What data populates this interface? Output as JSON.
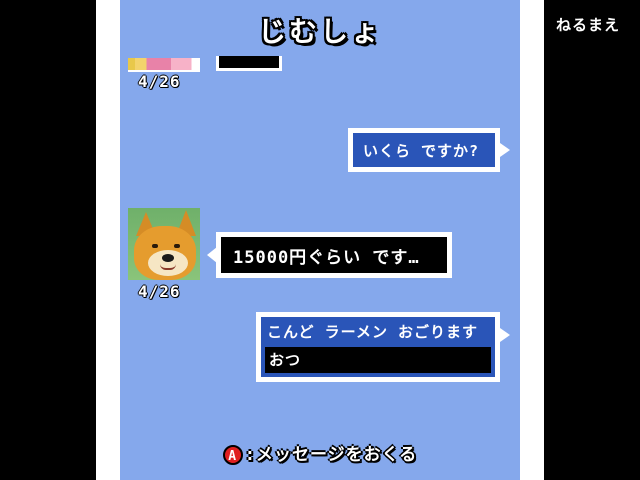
{
  "screen": {
    "title": "じむしょ",
    "corner_label": "ねるまえ"
  },
  "messages": [
    {
      "from": "contact",
      "date": "4/26",
      "text": ""
    },
    {
      "from": "player",
      "text": "いくら ですか?"
    },
    {
      "from": "contact",
      "date": "4/26",
      "text": "15000円ぐらい です…",
      "avatar": "shiba-dog"
    }
  ],
  "reply": {
    "line1": "こんど ラーメン おごります",
    "line2": "おつ"
  },
  "hint": {
    "button": "A",
    "text": ":メッセージをおくる"
  },
  "colors": {
    "screen_bg": "#85a8ec",
    "bubble_player": "#2a55b8",
    "bubble_contact": "#000000",
    "a_button": "#e02020"
  }
}
